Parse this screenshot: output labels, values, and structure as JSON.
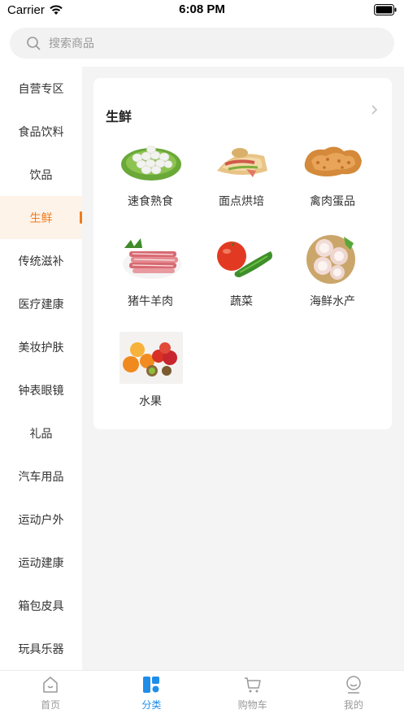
{
  "status_bar": {
    "carrier": "Carrier",
    "time": "6:08 PM"
  },
  "search": {
    "placeholder": "搜索商品"
  },
  "sidebar": {
    "items": [
      {
        "label": "自营专区"
      },
      {
        "label": "食品饮料"
      },
      {
        "label": "饮品"
      },
      {
        "label": "生鲜",
        "active": true
      },
      {
        "label": "传统滋补"
      },
      {
        "label": "医疗建康"
      },
      {
        "label": "美妆护肤"
      },
      {
        "label": "钟表眼镜"
      },
      {
        "label": "礼品"
      },
      {
        "label": "汽车用品"
      },
      {
        "label": "运动户外"
      },
      {
        "label": "运动建康"
      },
      {
        "label": "箱包皮具"
      },
      {
        "label": "玩具乐器"
      }
    ]
  },
  "category": {
    "title": "生鲜",
    "items": [
      {
        "label": "速食熟食",
        "icon": "quail-eggs-image"
      },
      {
        "label": "面点烘培",
        "icon": "crepe-image"
      },
      {
        "label": "禽肉蛋品",
        "icon": "fried-chicken-image"
      },
      {
        "label": "猪牛羊肉",
        "icon": "meat-slices-image"
      },
      {
        "label": "蔬菜",
        "icon": "tomato-cucumber-image"
      },
      {
        "label": "海鲜水产",
        "icon": "scallops-image"
      },
      {
        "label": "水果",
        "icon": "fruits-image"
      }
    ]
  },
  "tabs": [
    {
      "label": "首页",
      "icon": "home-icon"
    },
    {
      "label": "分类",
      "icon": "category-icon",
      "active": true
    },
    {
      "label": "购物车",
      "icon": "cart-icon"
    },
    {
      "label": "我的",
      "icon": "profile-icon"
    }
  ],
  "colors": {
    "accent": "#f07b1d",
    "tab_active": "#1f8de8",
    "background": "#f4f4f4"
  }
}
